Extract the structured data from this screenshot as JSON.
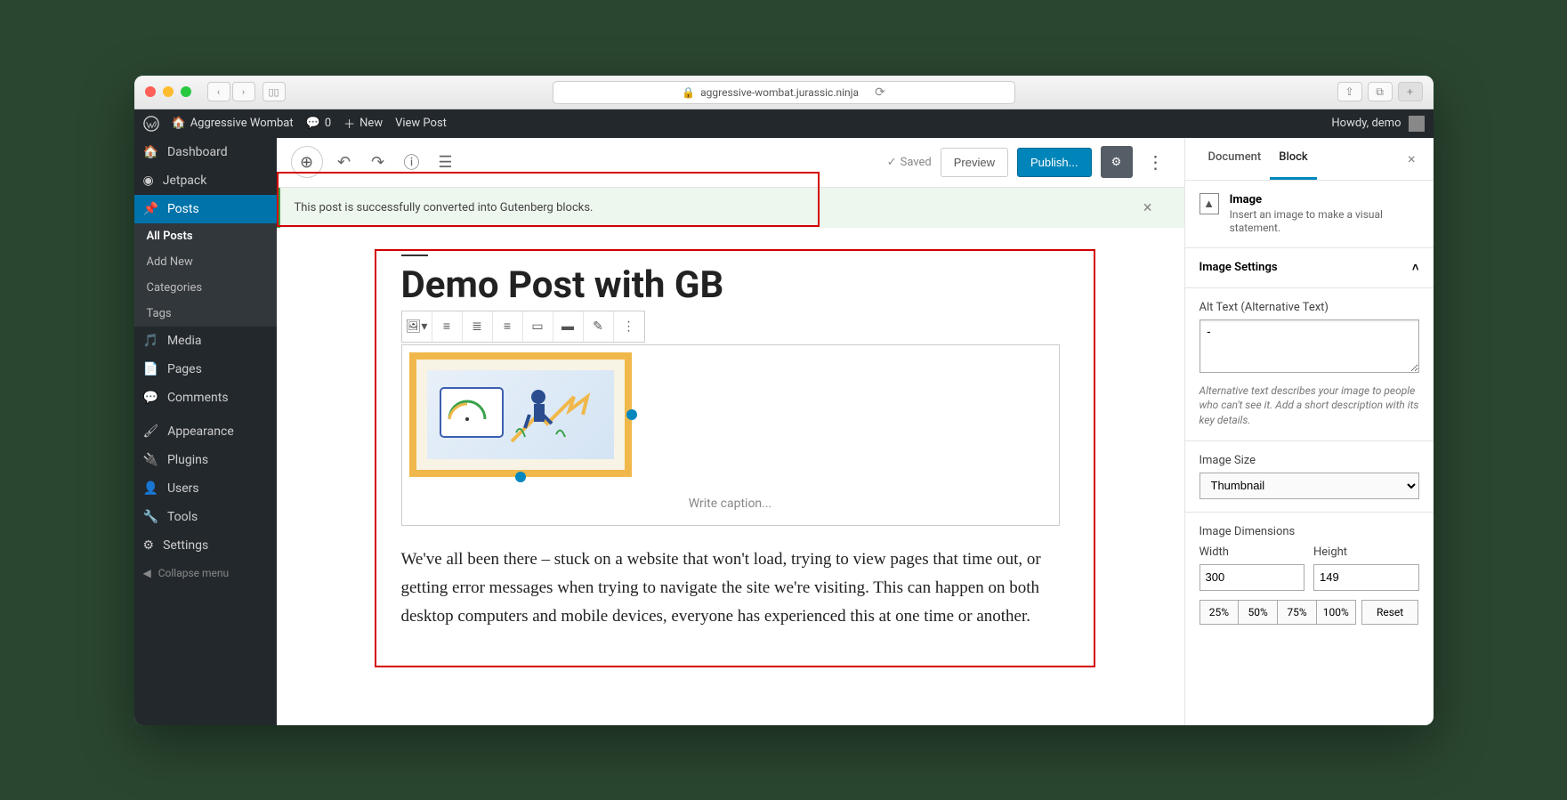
{
  "browser": {
    "url": "aggressive-wombat.jurassic.ninja"
  },
  "adminbar": {
    "site_name": "Aggressive Wombat",
    "comments_count": "0",
    "new_label": "New",
    "view_post": "View Post",
    "howdy": "Howdy, demo"
  },
  "sidebar": {
    "dashboard": "Dashboard",
    "jetpack": "Jetpack",
    "posts": "Posts",
    "posts_sub": {
      "all": "All Posts",
      "add": "Add New",
      "cat": "Categories",
      "tags": "Tags"
    },
    "media": "Media",
    "pages": "Pages",
    "comments": "Comments",
    "appearance": "Appearance",
    "plugins": "Plugins",
    "users": "Users",
    "tools": "Tools",
    "settings": "Settings",
    "collapse": "Collapse menu"
  },
  "toolbar": {
    "saved": "Saved",
    "preview": "Preview",
    "publish": "Publish..."
  },
  "notice": {
    "text": "This post is successfully converted into Gutenberg blocks."
  },
  "post": {
    "title": "Demo Post with GB",
    "caption_placeholder": "Write caption...",
    "body": "We've all been there – stuck on a website that won't load, trying to view pages that time out, or getting error messages when trying to navigate the site we're visiting. This can happen on both desktop computers and mobile devices, everyone has experienced this at one time or another."
  },
  "inspector": {
    "tab_document": "Document",
    "tab_block": "Block",
    "block_name": "Image",
    "block_desc": "Insert an image to make a visual statement.",
    "settings_title": "Image Settings",
    "alt_label": "Alt Text (Alternative Text)",
    "alt_value": "-",
    "alt_help": "Alternative text describes your image to people who can't see it. Add a short description with its key details.",
    "size_label": "Image Size",
    "size_value": "Thumbnail",
    "dims_label": "Image Dimensions",
    "width_label": "Width",
    "height_label": "Height",
    "width_value": "300",
    "height_value": "149",
    "pct25": "25%",
    "pct50": "50%",
    "pct75": "75%",
    "pct100": "100%",
    "reset": "Reset"
  }
}
